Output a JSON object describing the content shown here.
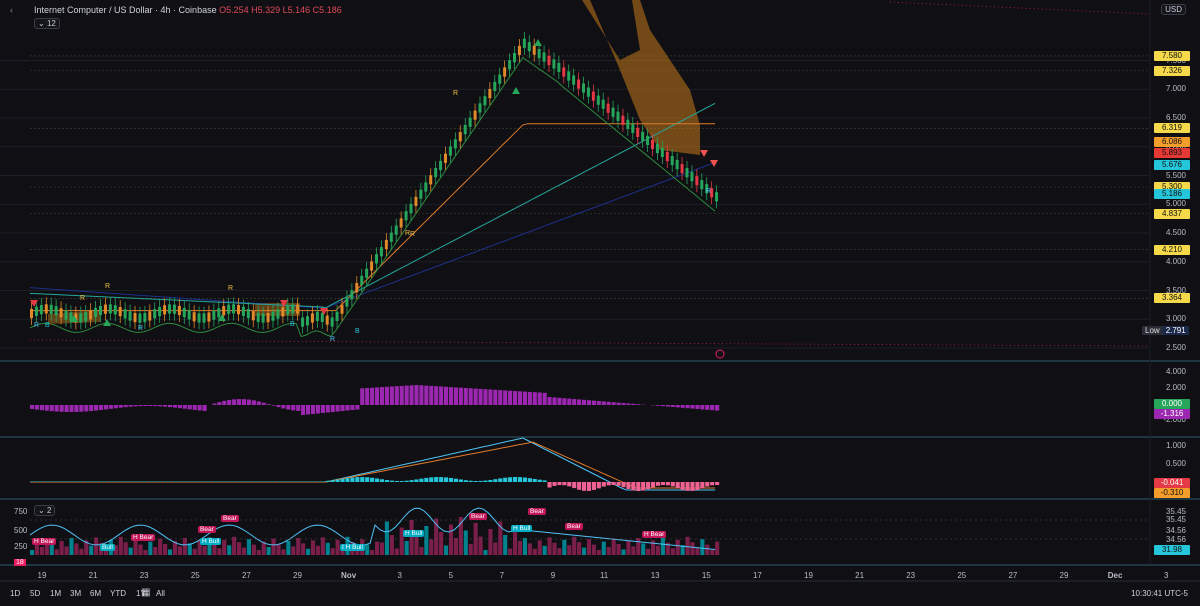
{
  "header": {
    "symbol": "Internet Computer / US Dollar · 4h · Coinbase",
    "ohlc": "O5.254 H5.329 L5.146 C5.186",
    "interval_badge": "12",
    "currency": "USD"
  },
  "price_scale": {
    "ticks": [
      "7.500",
      "7.000",
      "6.500",
      "6.000",
      "5.500",
      "5.000",
      "4.500",
      "4.000",
      "3.500",
      "3.000",
      "2.500"
    ],
    "labels": [
      {
        "text": "7.580",
        "color": "#f5d94a"
      },
      {
        "text": "7.326",
        "color": "#f5d94a"
      },
      {
        "text": "6.319",
        "color": "#f5d94a"
      },
      {
        "text": "6.086",
        "color": "#f59d2a"
      },
      {
        "text": "5.893",
        "color": "#e53935"
      },
      {
        "text": "5.676",
        "color": "#26c6da"
      },
      {
        "text": "5.300",
        "color": "#f5d94a"
      },
      {
        "text": "5.186",
        "color": "#26c6da"
      },
      {
        "text": "4.837",
        "color": "#f5d94a"
      },
      {
        "text": "4.210",
        "color": "#f5d94a"
      },
      {
        "text": "3.364",
        "color": "#f5d94a"
      }
    ],
    "low_label": "Low",
    "low_value": "2.791"
  },
  "osc1": {
    "ticks": [
      "4.000",
      "2.000",
      "-2.000"
    ],
    "value_green": "0.000",
    "value_purple": "-1.316"
  },
  "osc2": {
    "ticks": [
      "1.000",
      "0.500"
    ],
    "value_red": "-0.041",
    "value_orange": "-0.310"
  },
  "osc3": {
    "badge": "2",
    "left_ticks": [
      "750",
      "500",
      "250"
    ],
    "left_value": "18",
    "right_ticks": [
      "35.45",
      "35.45",
      "34.56",
      "34.56"
    ],
    "right_value": "31.98",
    "tags": [
      "H Bear",
      "Bull",
      "H Bear",
      "Bear",
      "Bear",
      "H Bull",
      "I H Bull",
      "H Bull",
      "Bear",
      "H Bull",
      "Bear",
      "Bear",
      "H Bear"
    ]
  },
  "xaxis": [
    "19",
    "21",
    "23",
    "25",
    "27",
    "29",
    "Nov",
    "3",
    "5",
    "7",
    "9",
    "11",
    "13",
    "15",
    "17",
    "19",
    "21",
    "23",
    "25",
    "27",
    "29",
    "Dec",
    "3"
  ],
  "toolbar": {
    "ranges": [
      "1D",
      "5D",
      "1M",
      "3M",
      "6M",
      "YTD",
      "1Y",
      "All"
    ],
    "clock": "10:30:41 UTC-5"
  },
  "signals": [
    "R",
    "B",
    "R",
    "R"
  ]
}
